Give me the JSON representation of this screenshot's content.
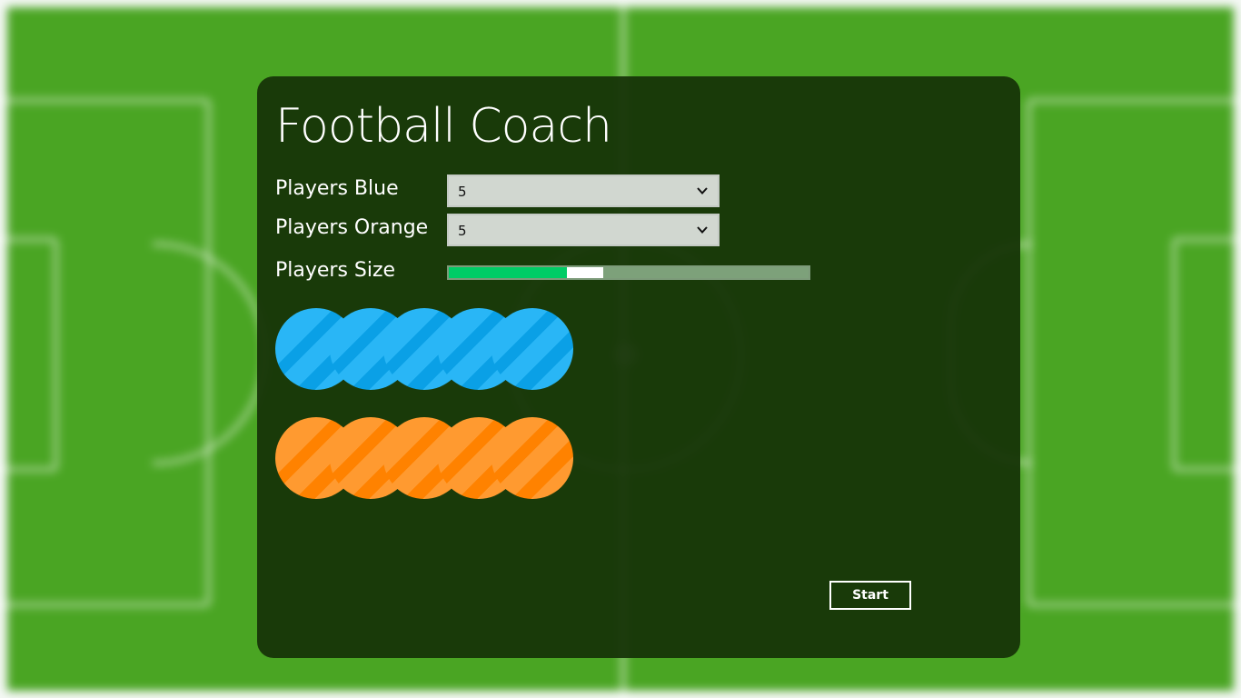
{
  "app": {
    "title": "Football Coach"
  },
  "settings": {
    "players_blue": {
      "label": "Players Blue",
      "value": "5"
    },
    "players_orange": {
      "label": "Players Orange",
      "value": "5"
    },
    "players_size": {
      "label": "Players Size",
      "value_fraction": 0.38
    }
  },
  "teams": {
    "blue": {
      "count": 5,
      "color": "#29b6f6",
      "shade": "#0aa0e6"
    },
    "orange": {
      "count": 5,
      "color": "#ff9a30",
      "shade": "#ff8200"
    }
  },
  "actions": {
    "start_label": "Start"
  },
  "icons": {
    "dropdown": "chevron-down-icon"
  }
}
